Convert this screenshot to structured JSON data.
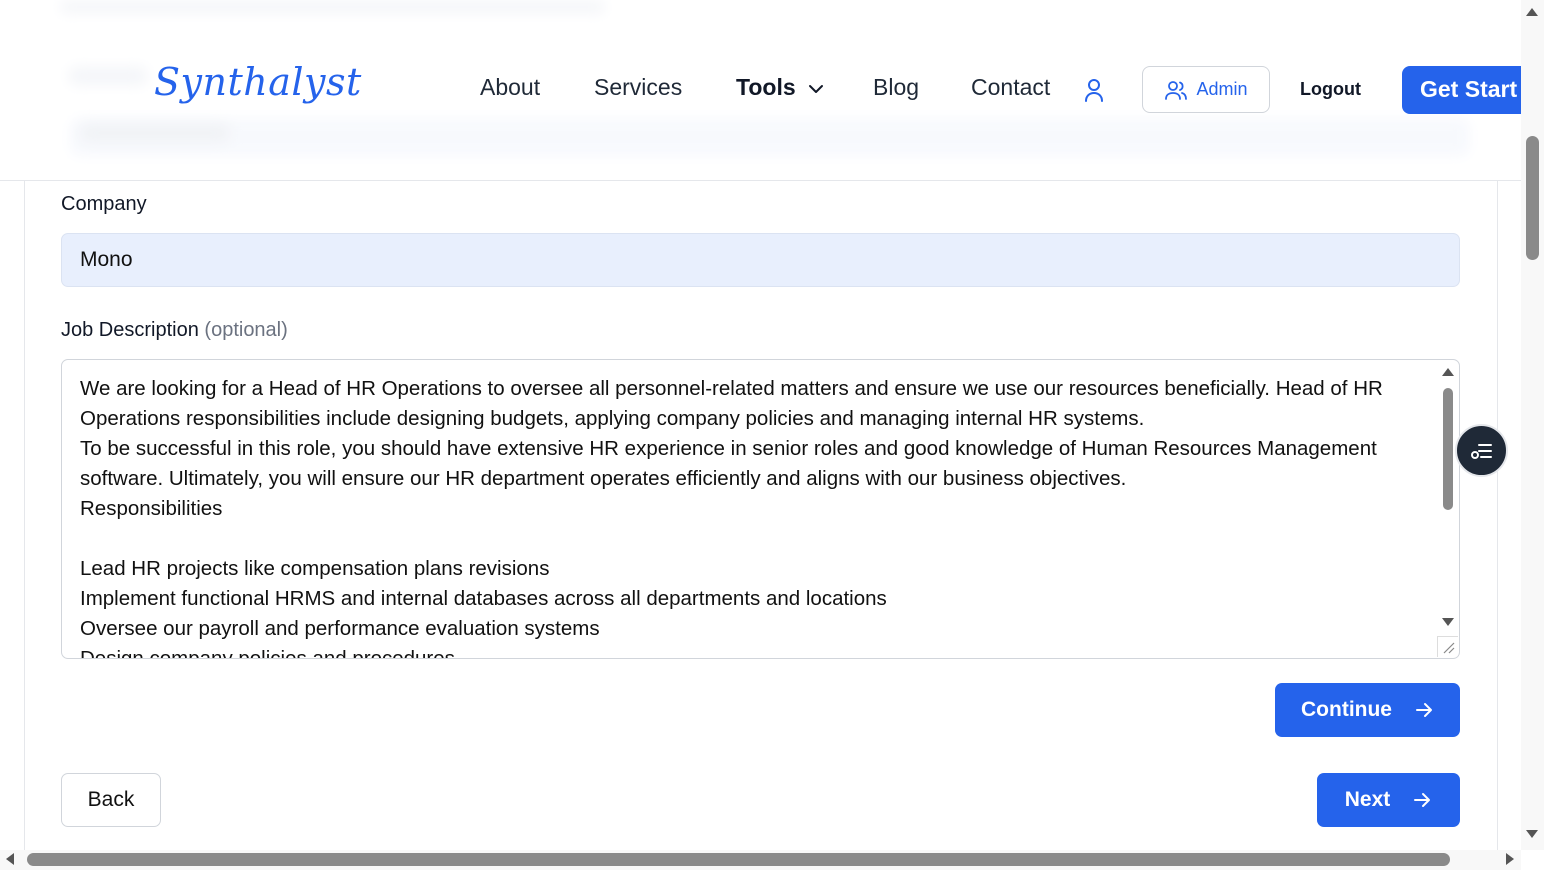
{
  "header": {
    "logo": "Synthalyst",
    "nav": {
      "about": "About",
      "services": "Services",
      "tools": "Tools",
      "blog": "Blog",
      "contact": "Contact"
    },
    "admin_label": "Admin",
    "logout_label": "Logout",
    "get_started_label": "Get Start"
  },
  "form": {
    "company_label": "Company",
    "company_value": "Mono",
    "job_description_label": "Job Description",
    "job_description_optional": "(optional)",
    "job_description_value": "We are looking for a Head of HR Operations to oversee all personnel-related matters and ensure we use our resources beneficially. Head of HR Operations responsibilities include designing budgets, applying company policies and managing internal HR systems.\nTo be successful in this role, you should have extensive HR experience in senior roles and good knowledge of Human Resources Management software. Ultimately, you will ensure our HR department operates efficiently and aligns with our business objectives.\nResponsibilities\n\nLead HR projects like compensation plans revisions\nImplement functional HRMS and internal databases across all departments and locations\nOversee our payroll and performance evaluation systems\nDesign company policies and procedures",
    "continue_label": "Continue",
    "back_label": "Back",
    "next_label": "Next"
  },
  "colors": {
    "accent": "#2563eb",
    "input_fill": "#e8effd"
  },
  "icons": {
    "user": "user-icon",
    "admin": "users-icon",
    "tools": "chevron-down-icon",
    "continue": "arrow-right-icon",
    "next": "arrow-right-icon",
    "floating": "list-icon"
  }
}
